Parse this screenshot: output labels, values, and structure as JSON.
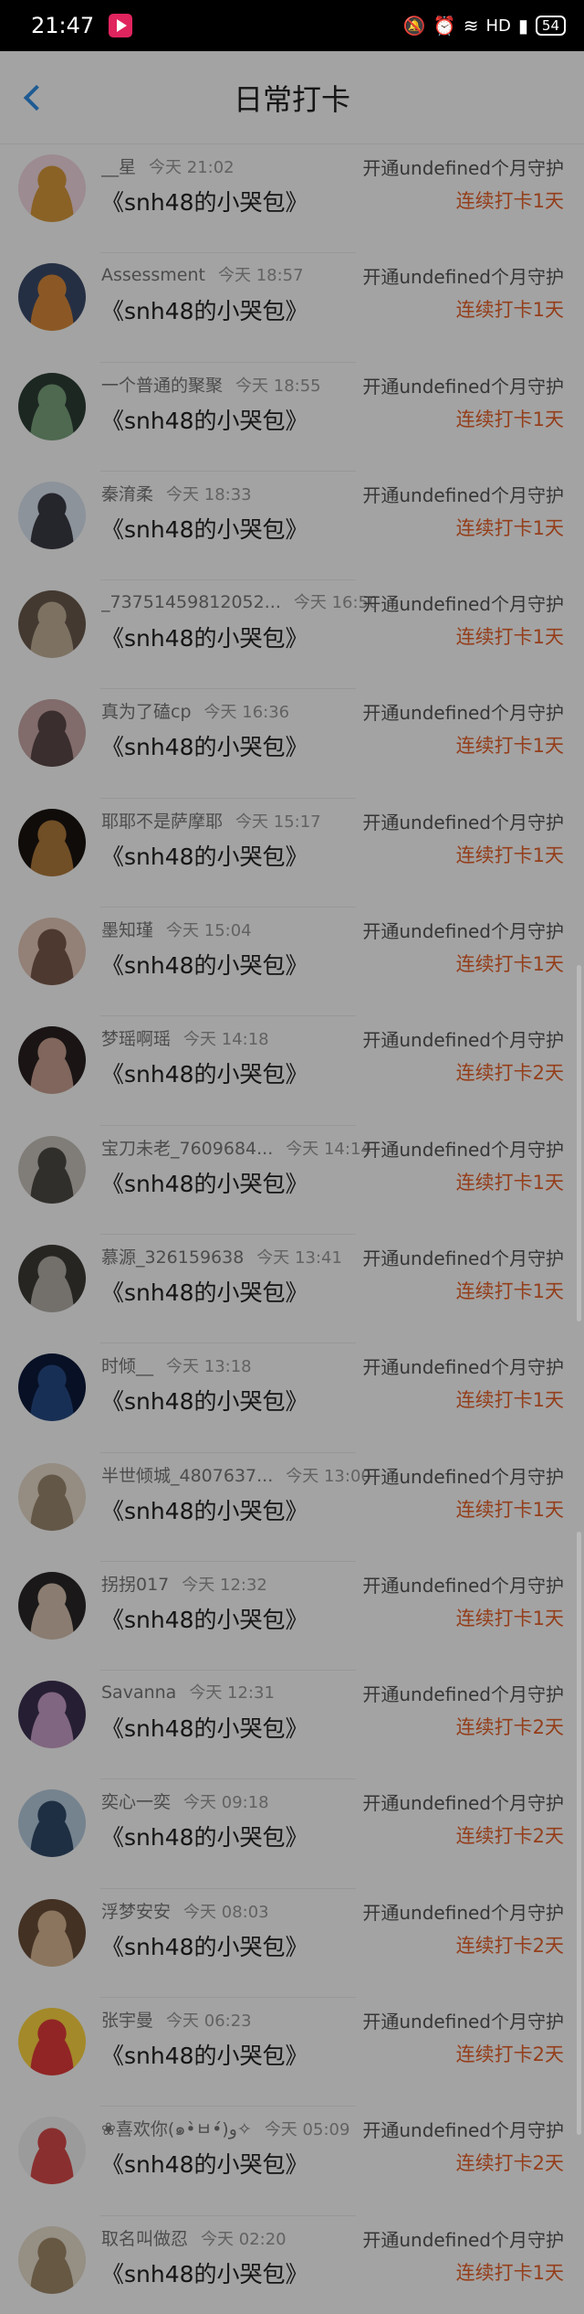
{
  "status": {
    "time": "21:47",
    "network": "HD",
    "battery": "54"
  },
  "nav": {
    "title": "日常打卡"
  },
  "records": [
    {
      "name": "__星",
      "time": "今天 21:02",
      "content": "《snh48的小哭包》",
      "guard": "开通undefined个月守护",
      "streak": "连续打卡1天"
    },
    {
      "name": "Assessment",
      "time": "今天 18:57",
      "content": "《snh48的小哭包》",
      "guard": "开通undefined个月守护",
      "streak": "连续打卡1天"
    },
    {
      "name": "一个普通的聚聚",
      "time": "今天 18:55",
      "content": "《snh48的小哭包》",
      "guard": "开通undefined个月守护",
      "streak": "连续打卡1天"
    },
    {
      "name": "秦淯柔",
      "time": "今天 18:33",
      "content": "《snh48的小哭包》",
      "guard": "开通undefined个月守护",
      "streak": "连续打卡1天"
    },
    {
      "name": "_73751459812052...",
      "time": "今天 16:50",
      "content": "《snh48的小哭包》",
      "guard": "开通undefined个月守护",
      "streak": "连续打卡1天"
    },
    {
      "name": "真为了磕cp",
      "time": "今天 16:36",
      "content": "《snh48的小哭包》",
      "guard": "开通undefined个月守护",
      "streak": "连续打卡1天"
    },
    {
      "name": "耶耶不是萨摩耶",
      "time": "今天 15:17",
      "content": "《snh48的小哭包》",
      "guard": "开通undefined个月守护",
      "streak": "连续打卡1天"
    },
    {
      "name": "墨知瑾",
      "time": "今天 15:04",
      "content": "《snh48的小哭包》",
      "guard": "开通undefined个月守护",
      "streak": "连续打卡1天"
    },
    {
      "name": "梦瑶啊瑶",
      "time": "今天 14:18",
      "content": "《snh48的小哭包》",
      "guard": "开通undefined个月守护",
      "streak": "连续打卡2天"
    },
    {
      "name": "宝刀未老_7609684...",
      "time": "今天 14:14",
      "content": "《snh48的小哭包》",
      "guard": "开通undefined个月守护",
      "streak": "连续打卡1天"
    },
    {
      "name": "慕源_326159638",
      "time": "今天 13:41",
      "content": "《snh48的小哭包》",
      "guard": "开通undefined个月守护",
      "streak": "连续打卡1天"
    },
    {
      "name": "时倾__",
      "time": "今天 13:18",
      "content": "《snh48的小哭包》",
      "guard": "开通undefined个月守护",
      "streak": "连续打卡1天"
    },
    {
      "name": "半世倾城_4807637...",
      "time": "今天 13:00",
      "content": "《snh48的小哭包》",
      "guard": "开通undefined个月守护",
      "streak": "连续打卡1天"
    },
    {
      "name": "拐拐017",
      "time": "今天 12:32",
      "content": "《snh48的小哭包》",
      "guard": "开通undefined个月守护",
      "streak": "连续打卡1天"
    },
    {
      "name": "Savanna",
      "time": "今天 12:31",
      "content": "《snh48的小哭包》",
      "guard": "开通undefined个月守护",
      "streak": "连续打卡2天"
    },
    {
      "name": "奕心一奕",
      "time": "今天 09:18",
      "content": "《snh48的小哭包》",
      "guard": "开通undefined个月守护",
      "streak": "连续打卡2天"
    },
    {
      "name": "浮梦安安",
      "time": "今天 08:03",
      "content": "《snh48的小哭包》",
      "guard": "开通undefined个月守护",
      "streak": "连续打卡2天"
    },
    {
      "name": "张宇曼",
      "time": "今天 06:23",
      "content": "《snh48的小哭包》",
      "guard": "开通undefined个月守护",
      "streak": "连续打卡2天"
    },
    {
      "name": "❀喜欢你(๑•̀ㅂ•́)و✧",
      "time": "今天 05:09",
      "content": "《snh48的小哭包》",
      "guard": "开通undefined个月守护",
      "streak": "连续打卡2天"
    },
    {
      "name": "取名叫做忍",
      "time": "今天 02:20",
      "content": "《snh48的小哭包》",
      "guard": "开通undefined个月守护",
      "streak": "连续打卡1天"
    }
  ],
  "avatar_colors": [
    [
      "#f4d9e2",
      "#d89a3c"
    ],
    [
      "#3b4a6b",
      "#d98a3a"
    ],
    [
      "#2c3e34",
      "#7ba47e"
    ],
    [
      "#dbe6f2",
      "#3a3a46"
    ],
    [
      "#6a5a4c",
      "#c4b29a"
    ],
    [
      "#caa8a8",
      "#5c4848"
    ],
    [
      "#1a1410",
      "#b07a3c"
    ],
    [
      "#e7c9b9",
      "#7b5a4b"
    ],
    [
      "#2a2020",
      "#c8a090"
    ],
    [
      "#c9c4bd",
      "#4e4a44"
    ],
    [
      "#3c3a36",
      "#b4b0a8"
    ],
    [
      "#0b1a3a",
      "#274a86"
    ],
    [
      "#e9dccb",
      "#9c8870"
    ],
    [
      "#2a2626",
      "#d8c3b0"
    ],
    [
      "#3c3050",
      "#c9a0c8"
    ],
    [
      "#b7cde0",
      "#2f4a6a"
    ],
    [
      "#6a4e38",
      "#d9b894"
    ],
    [
      "#ffd640",
      "#e33b3b"
    ],
    [
      "#f2f2f2",
      "#d84a4a"
    ],
    [
      "#eae0cf",
      "#a08a6a"
    ]
  ]
}
